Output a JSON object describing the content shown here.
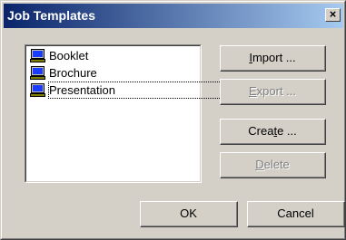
{
  "window": {
    "title": "Job Templates",
    "close_label": "×"
  },
  "templates": [
    {
      "label": "Booklet",
      "icon": "computer-icon",
      "focused": false
    },
    {
      "label": "Brochure",
      "icon": "computer-icon",
      "focused": false
    },
    {
      "label": "Presentation",
      "icon": "computer-icon",
      "focused": true
    }
  ],
  "buttons": {
    "import": {
      "pre": "",
      "mnemonic": "I",
      "post": "mport ...",
      "enabled": true
    },
    "export": {
      "pre": "",
      "mnemonic": "E",
      "post": "xport ...",
      "enabled": false
    },
    "create": {
      "pre": "Crea",
      "mnemonic": "t",
      "post": "e ...",
      "enabled": true
    },
    "delete": {
      "pre": "",
      "mnemonic": "D",
      "post": "elete",
      "enabled": false
    },
    "ok": "OK",
    "cancel": "Cancel"
  },
  "colors": {
    "titlebar_start": "#0a246a",
    "titlebar_end": "#a6caf0",
    "face": "#d4d0c8",
    "disabled_text": "#808080"
  }
}
